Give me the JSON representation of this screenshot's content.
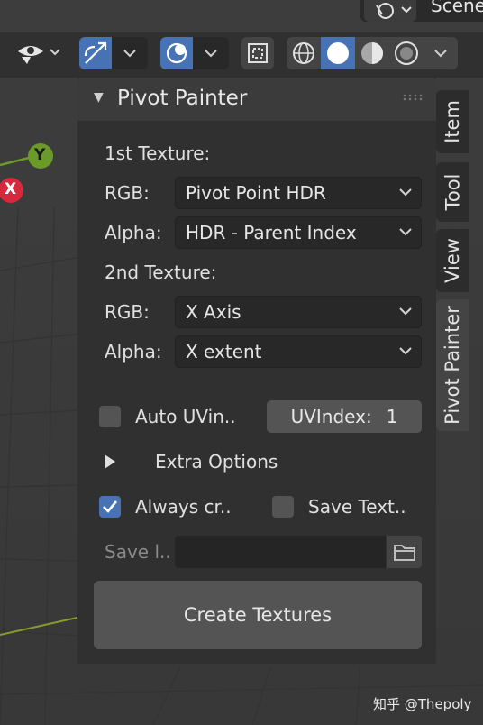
{
  "scene": {
    "label": "Scene"
  },
  "toolbar": {
    "icons": [
      "visibility-eye-icon",
      "gizmo-icon",
      "overlay-icon",
      "xray-icon",
      "wireframe-shading-icon",
      "solid-shading-icon",
      "material-shading-icon",
      "rendered-shading-icon"
    ]
  },
  "axes": {
    "y": "Y",
    "x": "X"
  },
  "panel": {
    "title": "Pivot Painter",
    "first_texture": {
      "heading": "1st Texture:",
      "rgb_label": "RGB:",
      "rgb_value": "Pivot Point HDR",
      "alpha_label": "Alpha:",
      "alpha_value": "HDR - Parent Index"
    },
    "second_texture": {
      "heading": "2nd Texture:",
      "rgb_label": "RGB:",
      "rgb_value": "X Axis",
      "alpha_label": "Alpha:",
      "alpha_value": "X extent"
    },
    "auto_uv": {
      "label": "Auto UVin..",
      "checked": false
    },
    "uv_index": {
      "label": "UVIndex:",
      "value": "1"
    },
    "extra_options": {
      "label": "Extra Options"
    },
    "always_create": {
      "label": "Always cr..",
      "checked": true
    },
    "save_textures": {
      "label": "Save Text..",
      "checked": false
    },
    "save_location": {
      "label": "Save l..",
      "value": ""
    },
    "create_button": "Create Textures"
  },
  "tabs": [
    "Item",
    "Tool",
    "View",
    "Pivot Painter"
  ],
  "watermark": "知乎 @Thepoly",
  "colors": {
    "accent": "#4772b3",
    "axis_y": "#6a9a2a",
    "axis_x": "#d8283e",
    "panel_bg": "#303030"
  }
}
